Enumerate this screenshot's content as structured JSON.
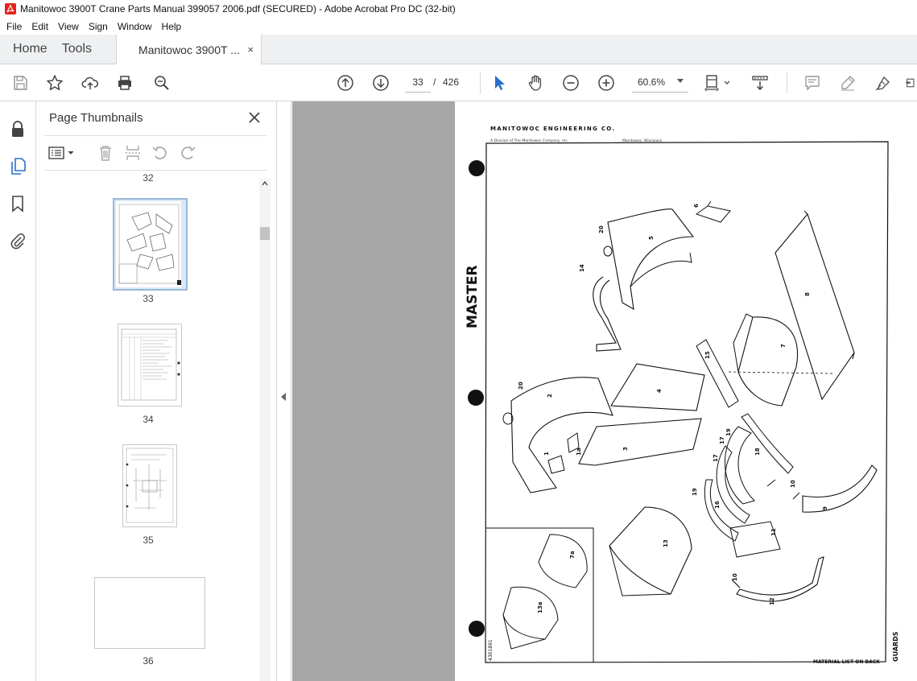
{
  "window": {
    "title": "Manitowoc 3900T Crane Parts Manual 399057 2006.pdf (SECURED) - Adobe Acrobat Pro DC (32-bit)"
  },
  "menu": [
    "File",
    "Edit",
    "View",
    "Sign",
    "Window",
    "Help"
  ],
  "tabs": {
    "home": "Home",
    "tools": "Tools",
    "document": "Manitowoc 3900T ...",
    "close": "×"
  },
  "toolbar": {
    "current_page": "33",
    "separator": "/",
    "total_pages": "426",
    "zoom": "60.6%"
  },
  "thumbnails_panel": {
    "title": "Page Thumbnails",
    "pages": [
      "32",
      "33",
      "34",
      "35",
      "36"
    ],
    "selected_page": "33"
  },
  "document": {
    "header": "MANITOWOC ENGINEERING CO.",
    "subheader_left": "A Division of The Manitowoc Company, Inc.",
    "subheader_right": "Manitowoc, Wisconsin",
    "side_label": "MASTER",
    "footer_right": "MATERIAL LIST ON BACK",
    "side_title": "GUARDS",
    "drawing_number": "4301891",
    "callouts": [
      "20",
      "5",
      "6",
      "14",
      "8",
      "7",
      "15",
      "4",
      "20",
      "2",
      "1",
      "1a",
      "3",
      "17",
      "19",
      "17",
      "18",
      "10",
      "9",
      "19",
      "16",
      "11",
      "13",
      "10",
      "12",
      "7a",
      "13a"
    ]
  },
  "colors": {
    "accent_blue": "#2b6fc9",
    "doc_bg": "#a7a7a7",
    "thumb_selected": "#d9e8f6"
  }
}
